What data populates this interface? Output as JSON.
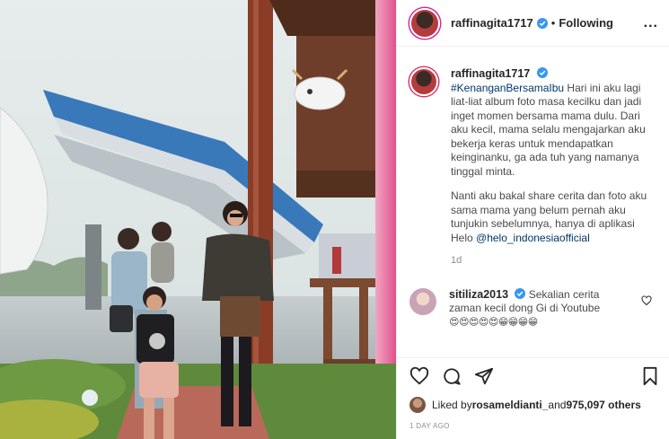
{
  "post": {
    "username": "raffinagita1717",
    "separator": "•",
    "follow_status": "Following",
    "more_label": "...",
    "caption": {
      "hashtag": "#KenanganBersamaIbu",
      "paragraph1_text": " Hari ini aku lagi liat-liat album foto masa kecilku dan jadi inget momen bersama mama dulu. Dari aku kecil, mama selalu mengajarkan aku bekerja keras untuk mendapatkan keinginanku, ga ada tuh yang namanya tinggal minta.",
      "paragraph2_text": "Nanti aku bakal share cerita dan foto aku sama mama yang belum pernah aku tunjukin sebelumnya, hanya di aplikasi Helo ",
      "mention": "@helo_indonesiaofficial",
      "age": "1d"
    },
    "comment": {
      "username": "sitiliza2013",
      "text": " Sekalian cerita zaman kecil dong Gi di Youtube",
      "emojis": "😍😍😍😍😍😁😁😁😁"
    },
    "likes": {
      "prefix": "Liked by ",
      "liker": "rosameldianti_",
      "middle": " and ",
      "count": "975,097 others"
    },
    "timestamp": "1 DAY AGO",
    "icons": {
      "verified": "verified-badge-icon",
      "like": "heart-icon",
      "comment": "comment-bubble-icon",
      "share": "paper-plane-icon",
      "save": "bookmark-icon",
      "more": "more-options-icon"
    },
    "colors": {
      "verified_blue": "#3897f0",
      "link_blue": "#00376b",
      "text_dark": "#262626",
      "text_muted": "#8e8e8e"
    }
  }
}
